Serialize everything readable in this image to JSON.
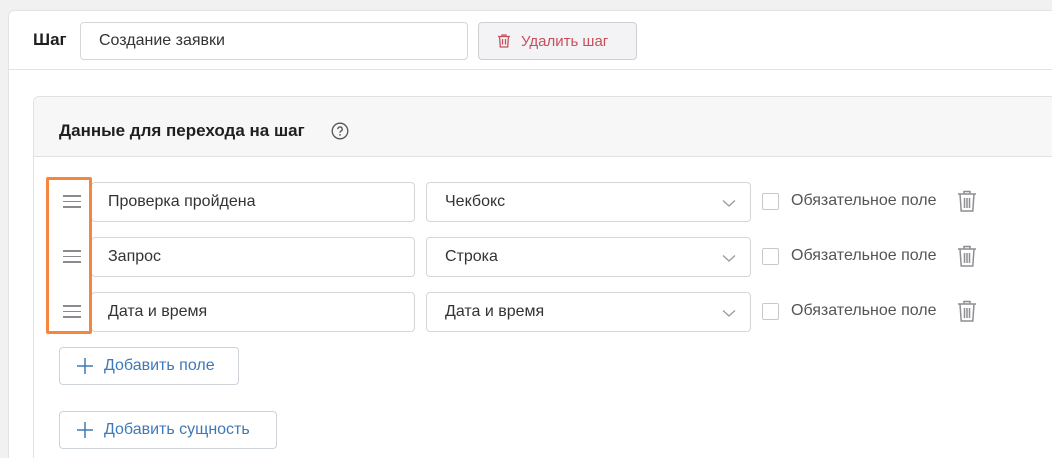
{
  "step": {
    "label": "Шаг",
    "name_value": "Создание заявки",
    "delete_label": "Удалить шаг"
  },
  "section": {
    "title": "Данные для перехода на шаг"
  },
  "fields": [
    {
      "name": "Проверка пройдена",
      "type": "Чекбокс",
      "required_label": "Обязательное поле",
      "required": false
    },
    {
      "name": "Запрос",
      "type": "Строка",
      "required_label": "Обязательное поле",
      "required": false
    },
    {
      "name": "Дата и время",
      "type": "Дата и время",
      "required_label": "Обязательное поле",
      "required": false
    }
  ],
  "actions": {
    "add_field_label": "Добавить поле",
    "add_entity_label": "Добавить сущность"
  },
  "colors": {
    "highlight": "#f5853f",
    "danger": "#c5505b",
    "link": "#3f78b8"
  },
  "icons": {
    "delete_step": "trash-icon",
    "help": "question-circle-icon",
    "drag": "drag-handle-icon",
    "dropdown": "chevron-down-icon",
    "remove_field": "trash-icon",
    "add": "plus-icon"
  }
}
